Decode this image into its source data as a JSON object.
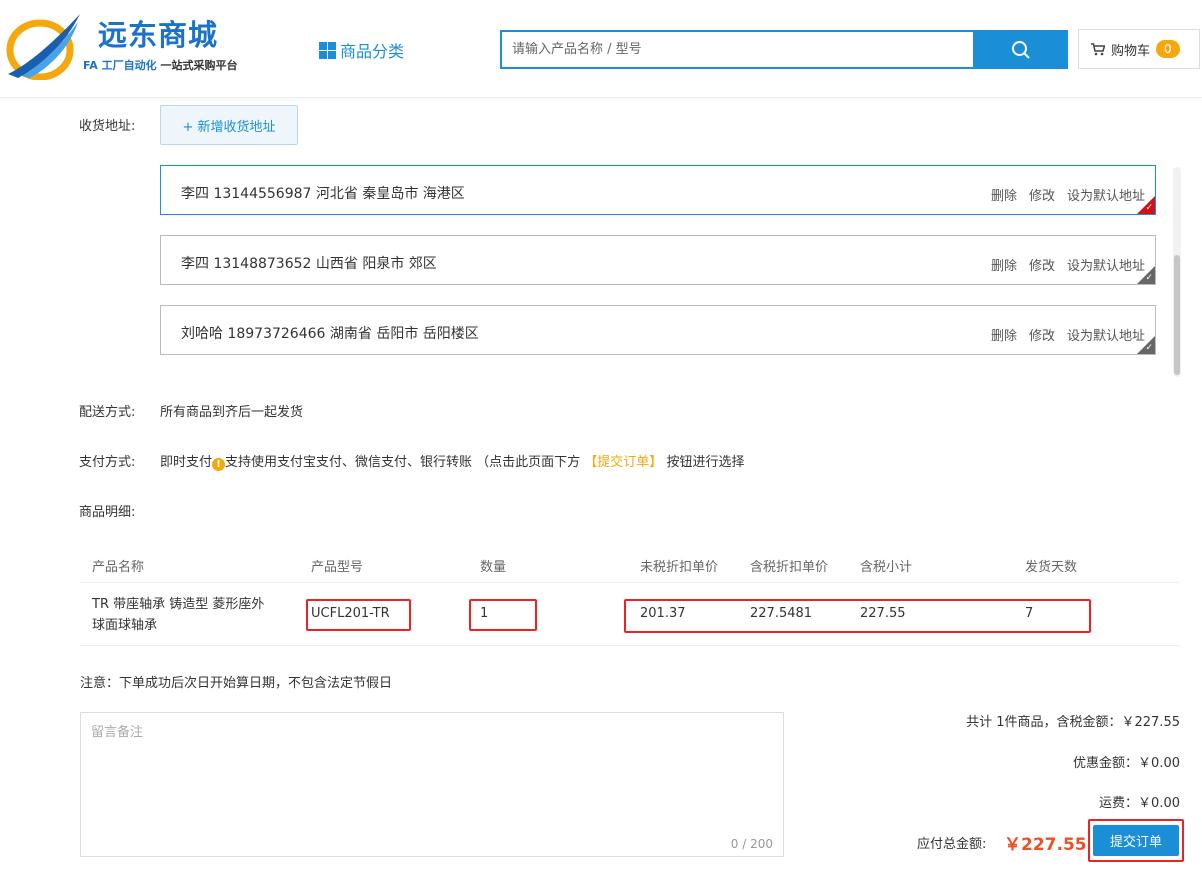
{
  "header": {
    "brand": "远东商城",
    "tagline_fa": "FA 工厂自动化",
    "tagline_rest": "一站式采购平台",
    "category_label": "商品分类",
    "search_placeholder": "请输入产品名称 / 型号",
    "cart_label": "购物车",
    "cart_count": "0"
  },
  "address": {
    "label": "收货地址:",
    "add_button": "+ 新增收货地址",
    "items": [
      {
        "text": "李四 13144556987 河北省 秦皇岛市 海港区",
        "selected": true
      },
      {
        "text": "李四 13148873652 山西省 阳泉市 郊区",
        "selected": false
      },
      {
        "text": "刘哈哈 18973726466 湖南省 岳阳市 岳阳楼区",
        "selected": false
      }
    ],
    "actions": {
      "delete": "删除",
      "edit": "修改",
      "set_default": "设为默认地址"
    }
  },
  "shipping": {
    "label": "配送方式:",
    "value": "所有商品到齐后一起发货"
  },
  "payment": {
    "label": "支付方式:",
    "method": "即时支付",
    "detail_prefix": "支持使用支付宝支付、微信支付、银行转账 （点击此页面下方",
    "detail_highlight": "【提交订单】",
    "detail_suffix": "按钮进行选择"
  },
  "products": {
    "label": "商品明细:",
    "headers": [
      "产品名称",
      "产品型号",
      "数量",
      "未税折扣单价",
      "含税折扣单价",
      "含税小计",
      "发货天数"
    ],
    "rows": [
      {
        "name_line1": "TR 带座轴承 铸造型 菱形座外",
        "name_line2": "球面球轴承",
        "model": "UCFL201-TR",
        "qty": "1",
        "untaxed_price": "201.37",
        "taxed_price": "227.5481",
        "subtotal": "227.55",
        "days": "7"
      }
    ]
  },
  "notice": "注意：下单成功后次日开始算日期，不包含法定节假日",
  "remark": {
    "placeholder": "留言备注",
    "count": "0 / 200"
  },
  "summary": {
    "line_items": "共计 1件商品，含税金额：￥227.55",
    "discount": "优惠金额：￥0.00",
    "freight": "运费：￥0.00",
    "total_label": "应付总金额:",
    "total_value": "￥227.55",
    "submit_label": "提交订单"
  },
  "colors": {
    "primary": "#1a8fd8",
    "accent": "#f5a70e",
    "total": "#f04e23",
    "highlight_box": "#e22222"
  }
}
